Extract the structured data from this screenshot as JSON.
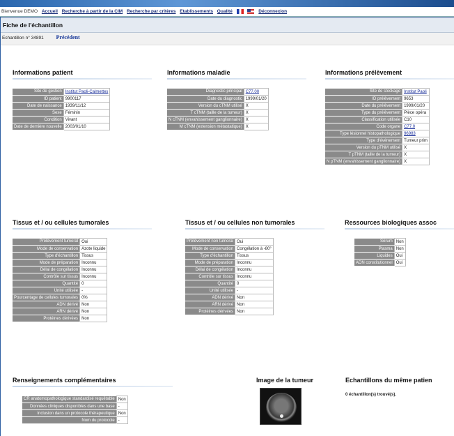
{
  "nav": {
    "welcome": "Bienvenue DEMO",
    "links": [
      "Accueil",
      "Recherche à partir de la CIM",
      "Recherche par critères",
      "Etablissements",
      "Qualité"
    ],
    "logout": "Déconnexion"
  },
  "page": {
    "title": "Fiche de l'échantillon",
    "echantillon": "Echantillon n° 34891",
    "previous": "Précédent"
  },
  "patient": {
    "title": "Informations patient",
    "rows": [
      {
        "k": "Site de gestion",
        "v": "Institut Paoli-Calmettes"
      },
      {
        "k": "ID patient",
        "v": "9900117"
      },
      {
        "k": "Date de naissance",
        "v": "1939/11/12"
      },
      {
        "k": "Sexe",
        "v": "Féminin"
      },
      {
        "k": "Condition",
        "v": "Vivant"
      },
      {
        "k": "Date de dernière nouvelle",
        "v": "2003/01/10"
      }
    ]
  },
  "maladie": {
    "title": "Informations maladie",
    "rows": [
      {
        "k": "Diagnostic principal",
        "v": "C77.00"
      },
      {
        "k": "Date du diagnostic",
        "v": "1999/01/20"
      },
      {
        "k": "Version du cTNM utilisé",
        "v": "X"
      },
      {
        "k": "T cTNM (taille de la tumeur)",
        "v": "X"
      },
      {
        "k": "N cTNM (envahissement ganglionnaire)",
        "v": "X"
      },
      {
        "k": "M cTNM (extension métastatique)",
        "v": "X"
      }
    ]
  },
  "prelevement": {
    "title": "Informations prélèvement",
    "rows": [
      {
        "k": "Site de stockage",
        "v": "Institut Paoli"
      },
      {
        "k": "ID prélèvement",
        "v": "9653"
      },
      {
        "k": "Date du prélèvement",
        "v": "1999/01/20"
      },
      {
        "k": "Type du prélèvement",
        "v": "Pièce opéra"
      },
      {
        "k": "Classification utilisée",
        "v": "C10"
      },
      {
        "k": "Code organe",
        "v": "C77.0"
      },
      {
        "k": "Type lésionnel histopathologique",
        "v": "96983"
      },
      {
        "k": "Type d'événement",
        "v": "Tumeur prim"
      },
      {
        "k": "Version du pTNM utilisé",
        "v": "X"
      },
      {
        "k": "T pTNM (taille de la tumeur)",
        "v": "X"
      },
      {
        "k": "N pTNM (envahissement ganglionnaire)",
        "v": "X"
      }
    ]
  },
  "tumorales": {
    "title": "Tissus et / ou cellules tumorales",
    "rows": [
      {
        "k": "Prélèvement tumoral",
        "v": "Oui"
      },
      {
        "k": "Mode de conservation",
        "v": "Azote liquide"
      },
      {
        "k": "Type d'échantillon",
        "v": "Tissus"
      },
      {
        "k": "Mode de préparation",
        "v": "Inconnu"
      },
      {
        "k": "Délai de congélation",
        "v": "Inconnu"
      },
      {
        "k": "Contrôle sur tissus",
        "v": "Inconnu"
      },
      {
        "k": "Quantité",
        "v": "0"
      },
      {
        "k": "Unité utilisée",
        "v": "-"
      },
      {
        "k": "Pourcentage de cellules tumorales",
        "v": "0%"
      },
      {
        "k": "ADN dérivé",
        "v": "Non"
      },
      {
        "k": "ARN dérivé",
        "v": "Non"
      },
      {
        "k": "Protéines dérivées",
        "v": "Non"
      }
    ]
  },
  "non_tumorales": {
    "title": "Tissus et / ou cellules non tumorales",
    "rows": [
      {
        "k": "Prélèvement non tumoral",
        "v": "Oui"
      },
      {
        "k": "Mode de conservation",
        "v": "Congélation à -80°"
      },
      {
        "k": "Type d'échantillon",
        "v": "Tissus"
      },
      {
        "k": "Mode de préparation",
        "v": "Inconnu"
      },
      {
        "k": "Délai de congélation",
        "v": "Inconnu"
      },
      {
        "k": "Contrôle sur tissus",
        "v": "Inconnu"
      },
      {
        "k": "Quantité",
        "v": "0"
      },
      {
        "k": "Unité utilisée",
        "v": "-"
      },
      {
        "k": "ADN dérivé",
        "v": "Non"
      },
      {
        "k": "ARN dérivé",
        "v": "Non"
      },
      {
        "k": "Protéines dérivées",
        "v": "Non"
      }
    ]
  },
  "ressources": {
    "title": "Ressources biologiques assoc",
    "rows": [
      {
        "k": "Sérum",
        "v": "Non"
      },
      {
        "k": "Plasma",
        "v": "Non"
      },
      {
        "k": "Liquides",
        "v": "Oui"
      },
      {
        "k": "ADN constitutionnel",
        "v": "Oui"
      }
    ]
  },
  "complementaires": {
    "title": "Renseignements complémentaires",
    "rows": [
      {
        "k": "CR anatomopathologique standardisé requêtable",
        "v": "Non"
      },
      {
        "k": "Données cliniques disponibles dans une base",
        "v": "-"
      },
      {
        "k": "Inclusion dans un protocole thérapeutique",
        "v": "Non"
      },
      {
        "k": "Nom du protocole",
        "v": "-"
      }
    ]
  },
  "image": {
    "title": "Image de la tumeur"
  },
  "meme_patient": {
    "title": "Echantillons du même patien",
    "found": "0 échantillon(s) trouvé(s)."
  }
}
